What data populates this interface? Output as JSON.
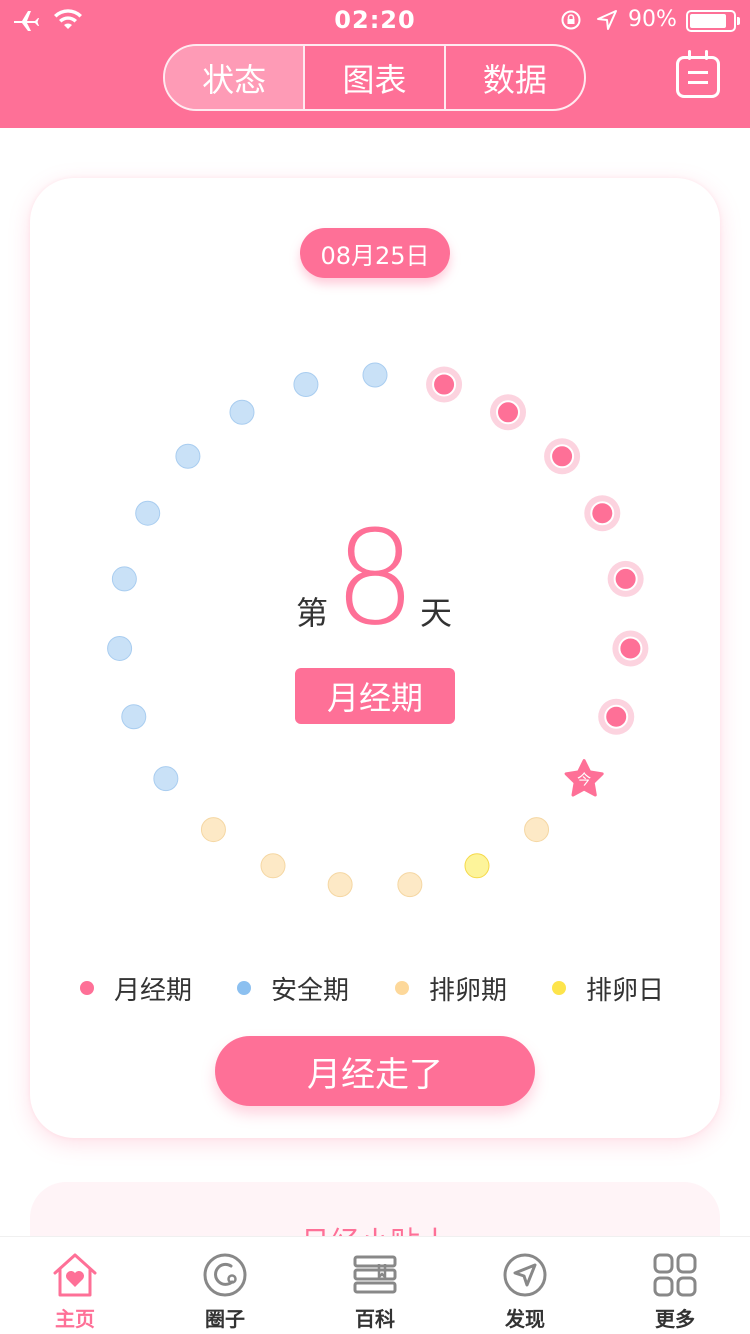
{
  "status_bar": {
    "time": "02:20",
    "battery": "90%"
  },
  "header": {
    "tabs": [
      {
        "label": "状态",
        "active": true
      },
      {
        "label": "图表",
        "active": false
      },
      {
        "label": "数据",
        "active": false
      }
    ],
    "calendar_icon": "calendar-icon"
  },
  "card": {
    "date": "08月25日",
    "day_prefix": "第",
    "day_number": "8",
    "day_suffix": "天",
    "phase": "月经期",
    "today_marker": "今",
    "cycle": [
      "safe",
      "period",
      "period",
      "period",
      "period",
      "period",
      "period",
      "period",
      "today",
      "ovulation",
      "ovulation_day",
      "ovulation",
      "ovulation",
      "ovulation",
      "ovulation",
      "safe",
      "safe",
      "safe",
      "safe",
      "safe",
      "safe",
      "safe",
      "safe"
    ],
    "legend": [
      {
        "label": "月经期",
        "color": "#fe7097"
      },
      {
        "label": "安全期",
        "color": "#8cc0f0"
      },
      {
        "label": "排卵期",
        "color": "#fdd89a"
      },
      {
        "label": "排卵日",
        "color": "#fde44b"
      }
    ],
    "action_button": "月经走了"
  },
  "tips": {
    "title": "月经小贴士"
  },
  "tabbar": [
    {
      "label": "主页",
      "icon": "home-heart-icon",
      "active": true
    },
    {
      "label": "圈子",
      "icon": "circle-icon",
      "active": false
    },
    {
      "label": "百科",
      "icon": "books-icon",
      "active": false
    },
    {
      "label": "发现",
      "icon": "compass-icon",
      "active": false
    },
    {
      "label": "更多",
      "icon": "grid-icon",
      "active": false
    }
  ],
  "colors": {
    "accent": "#fe7097",
    "safe": "#c9e1f7",
    "ovulation": "#fde9c6",
    "ovulation_day": "#fdf49a"
  }
}
